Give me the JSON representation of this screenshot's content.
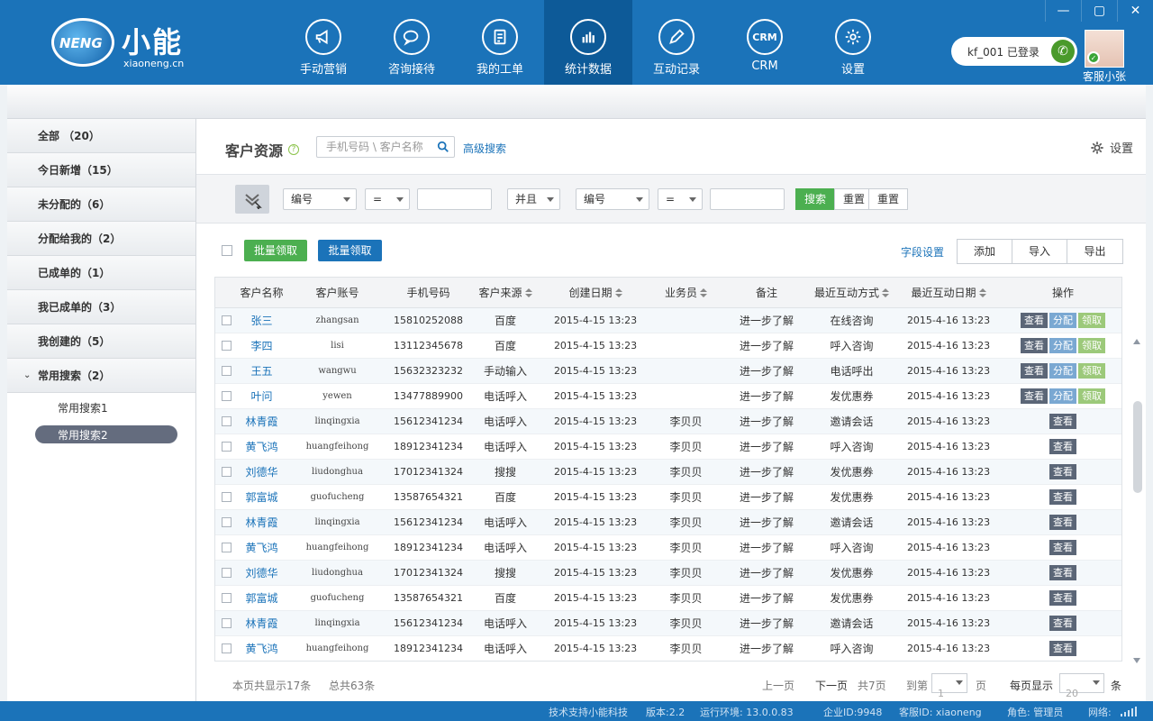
{
  "app": {
    "logo_badge": "NENG",
    "logo_name": "小能",
    "logo_url": "xiaoneng.cn"
  },
  "nav": [
    {
      "label": "手动营销",
      "icon": "megaphone-icon"
    },
    {
      "label": "咨询接待",
      "icon": "chat-bubble-icon"
    },
    {
      "label": "我的工单",
      "icon": "document-icon"
    },
    {
      "label": "统计数据",
      "icon": "bar-chart-icon",
      "active": true
    },
    {
      "label": "互动记录",
      "icon": "pencil-icon"
    },
    {
      "label": "CRM",
      "icon_text": "CRM",
      "icon": "crm-icon"
    },
    {
      "label": "设置",
      "icon": "gear-icon"
    }
  ],
  "window": {
    "minimize": "—",
    "maximize": "▢",
    "close": "✕"
  },
  "user": {
    "status": "kf_001  已登录",
    "name": "客服小张"
  },
  "sidebar": {
    "items": [
      {
        "label": "全部 （20）"
      },
      {
        "label": "今日新增（15）"
      },
      {
        "label": "未分配的（6）"
      },
      {
        "label": "分配给我的（2）"
      },
      {
        "label": "已成单的（1）"
      },
      {
        "label": "我已成单的（3）"
      },
      {
        "label": "我创建的（5）"
      },
      {
        "label": "常用搜索（2）",
        "expanded": true
      }
    ],
    "subitems": [
      {
        "label": "常用搜索1"
      },
      {
        "label": "常用搜索2",
        "active": true
      }
    ]
  },
  "main": {
    "title": "客户资源",
    "help": "?",
    "search_placeholder": "手机号码 \\ 客户名称",
    "advanced_search": "高级搜索",
    "settings": "设置"
  },
  "filter": {
    "field1": "编号",
    "op1": "=",
    "logic": "并且",
    "field2": "编号",
    "op2": "=",
    "search": "搜索",
    "reset1": "重置",
    "reset2": "重置"
  },
  "toolbar": {
    "batch_claim_1": "批量领取",
    "batch_claim_2": "批量领取",
    "field_settings": "字段设置",
    "add": "添加",
    "import": "导入",
    "export": "导出"
  },
  "table": {
    "columns": [
      "客户名称",
      "客户账号",
      "手机号码",
      "客户来源",
      "创建日期",
      "业务员",
      "备注",
      "最近互动方式",
      "最近互动日期",
      "操作"
    ],
    "action_labels": {
      "view": "查看",
      "assign": "分配",
      "claim": "领取"
    },
    "rows": [
      {
        "name": "张三",
        "account": "zhangsan",
        "phone": "15810252088",
        "source": "百度",
        "created": "2015-4-15 13:23",
        "agent": "",
        "note": "进一步了解",
        "method": "在线咨询",
        "last": "2015-4-16 13:23",
        "full": true
      },
      {
        "name": "李四",
        "account": "lisi",
        "phone": "13112345678",
        "source": "百度",
        "created": "2015-4-15 13:23",
        "agent": "",
        "note": "进一步了解",
        "method": "呼入咨询",
        "last": "2015-4-16 13:23",
        "full": true
      },
      {
        "name": "王五",
        "account": "wangwu",
        "phone": "15632323232",
        "source": "手动输入",
        "created": "2015-4-15 13:23",
        "agent": "",
        "note": "进一步了解",
        "method": "电话呼出",
        "last": "2015-4-16 13:23",
        "full": true
      },
      {
        "name": "叶问",
        "account": "yewen",
        "phone": "13477889900",
        "source": "电话呼入",
        "created": "2015-4-15 13:23",
        "agent": "",
        "note": "进一步了解",
        "method": "发优惠券",
        "last": "2015-4-16 13:23",
        "full": true
      },
      {
        "name": "林青霞",
        "account": "linqingxia",
        "phone": "15612341234",
        "source": "电话呼入",
        "created": "2015-4-15 13:23",
        "agent": "李贝贝",
        "note": "进一步了解",
        "method": "邀请会话",
        "last": "2015-4-16 13:23",
        "full": false
      },
      {
        "name": "黄飞鸿",
        "account": "huangfeihong",
        "phone": "18912341234",
        "source": "电话呼入",
        "created": "2015-4-15 13:23",
        "agent": "李贝贝",
        "note": "进一步了解",
        "method": "呼入咨询",
        "last": "2015-4-16 13:23",
        "full": false
      },
      {
        "name": "刘德华",
        "account": "liudonghua",
        "phone": "17012341324",
        "source": "搜搜",
        "created": "2015-4-15 13:23",
        "agent": "李贝贝",
        "note": "进一步了解",
        "method": "发优惠券",
        "last": "2015-4-16 13:23",
        "full": false
      },
      {
        "name": "郭富城",
        "account": "guofucheng",
        "phone": "13587654321",
        "source": "百度",
        "created": "2015-4-15 13:23",
        "agent": "李贝贝",
        "note": "进一步了解",
        "method": "发优惠券",
        "last": "2015-4-16 13:23",
        "full": false
      },
      {
        "name": "林青霞",
        "account": "linqingxia",
        "phone": "15612341234",
        "source": "电话呼入",
        "created": "2015-4-15 13:23",
        "agent": "李贝贝",
        "note": "进一步了解",
        "method": "邀请会话",
        "last": "2015-4-16 13:23",
        "full": false
      },
      {
        "name": "黄飞鸿",
        "account": "huangfeihong",
        "phone": "18912341234",
        "source": "电话呼入",
        "created": "2015-4-15 13:23",
        "agent": "李贝贝",
        "note": "进一步了解",
        "method": "呼入咨询",
        "last": "2015-4-16 13:23",
        "full": false
      },
      {
        "name": "刘德华",
        "account": "liudonghua",
        "phone": "17012341324",
        "source": "搜搜",
        "created": "2015-4-15 13:23",
        "agent": "李贝贝",
        "note": "进一步了解",
        "method": "发优惠券",
        "last": "2015-4-16 13:23",
        "full": false
      },
      {
        "name": "郭富城",
        "account": "guofucheng",
        "phone": "13587654321",
        "source": "百度",
        "created": "2015-4-15 13:23",
        "agent": "李贝贝",
        "note": "进一步了解",
        "method": "发优惠券",
        "last": "2015-4-16 13:23",
        "full": false
      },
      {
        "name": "林青霞",
        "account": "linqingxia",
        "phone": "15612341234",
        "source": "电话呼入",
        "created": "2015-4-15 13:23",
        "agent": "李贝贝",
        "note": "进一步了解",
        "method": "邀请会话",
        "last": "2015-4-16 13:23",
        "full": false
      },
      {
        "name": "黄飞鸿",
        "account": "huangfeihong",
        "phone": "18912341234",
        "source": "电话呼入",
        "created": "2015-4-15 13:23",
        "agent": "李贝贝",
        "note": "进一步了解",
        "method": "呼入咨询",
        "last": "2015-4-16 13:23",
        "full": false
      }
    ]
  },
  "pager": {
    "shown": "本页共显示17条",
    "total": "总共63条",
    "prev": "上一页",
    "next": "下一页",
    "pages": "共7页",
    "goto": "到第",
    "goto_value": "1",
    "page_unit": "页",
    "per_page": "每页显示",
    "per_page_value": "20",
    "item_unit": "条"
  },
  "status": {
    "support": "技术支持小能科技",
    "version": "版本:2.2",
    "env": "运行环境: 13.0.0.83",
    "company": "企业ID:9948",
    "agent_id": "客服ID: xiaoneng",
    "role": "角色: 管理员",
    "network": "网络:"
  }
}
